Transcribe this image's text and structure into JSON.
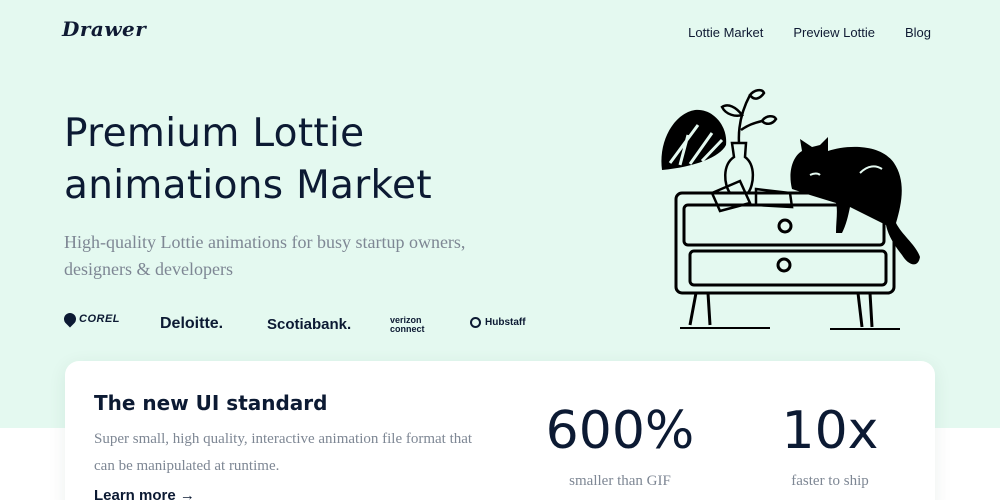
{
  "header": {
    "logo_text": "Drawer",
    "nav": [
      "Lottie Market",
      "Preview Lottie",
      "Blog"
    ]
  },
  "hero": {
    "title_line1": "Premium Lottie",
    "title_line2": "animations Market",
    "subtitle": "High-quality Lottie animations for busy startup owners, designers & developers",
    "logos": {
      "corel": "COREL",
      "deloitte": "Deloitte.",
      "scotiabank": "Scotiabank.",
      "verizon_line1": "verizon",
      "verizon_line2": "connect",
      "hubstaff": "Hubstaff"
    }
  },
  "feature_card": {
    "title": "The new UI standard",
    "description": "Super small, high quality, interactive animation file format that can be manipulated at runtime.",
    "link": "Learn more →",
    "stats": [
      {
        "value": "600%",
        "label": "smaller than GIF"
      },
      {
        "value": "10x",
        "label": "faster to ship"
      }
    ]
  },
  "colors": {
    "hero_background": "#e4f9f0",
    "text_dark": "#0c1a33",
    "text_muted": "#7e8794"
  }
}
